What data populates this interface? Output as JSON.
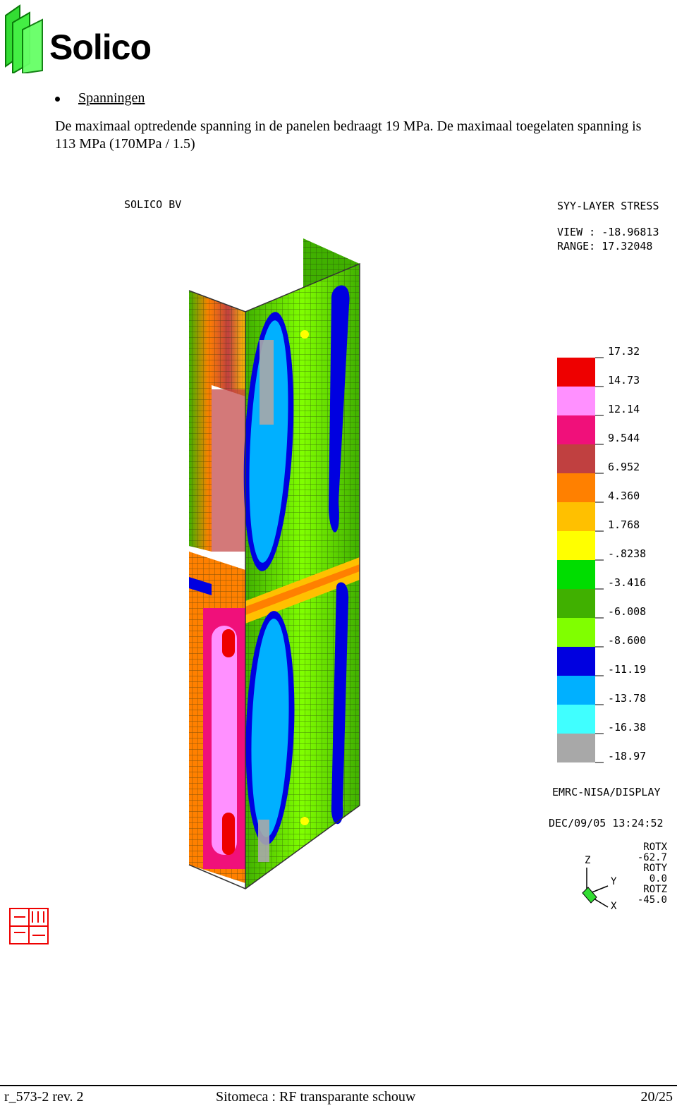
{
  "header": {
    "logo_text": "Solico"
  },
  "section": {
    "bullet_label": "Spanningen",
    "paragraph": "De maximaal optredende spanning in de panelen bedraagt 19 MPa.  De maximaal toegelaten spanning is 113 MPa (170MPa / 1.5)"
  },
  "figure": {
    "company": "SOLICO BV",
    "plot_title": "SYY-LAYER STRESS",
    "view_line": "VIEW : -18.96813",
    "range_line": "RANGE: 17.32048",
    "legend": {
      "values": [
        "17.32",
        "14.73",
        "12.14",
        "9.544",
        "6.952",
        "4.360",
        "1.768",
        "-.8238",
        "-3.416",
        "-6.008",
        "-8.600",
        "-11.19",
        "-13.78",
        "-16.38",
        "-18.97"
      ],
      "colors": [
        "#ee0000",
        "#ff90ff",
        "#f0107a",
        "#c04040",
        "#ff8000",
        "#ffc000",
        "#ffff00",
        "#00dd00",
        "#40b000",
        "#80ff00",
        "#0000e0",
        "#00b0ff",
        "#40ffff",
        "#a8a8a8"
      ]
    },
    "software": "EMRC-NISA/DISPLAY",
    "datetime": "DEC/09/05 13:24:52",
    "rotation": [
      "ROTX",
      "-62.7",
      "ROTY",
      "0.0",
      "ROTZ",
      "-45.0"
    ],
    "axes": {
      "z": "Z",
      "y": "Y",
      "x": "X"
    },
    "emrc_logo": "EMRC"
  },
  "footer": {
    "doc_id": "r_573-2  rev. 2",
    "title": "Sitomeca : RF transparante schouw",
    "page": "20/25"
  }
}
